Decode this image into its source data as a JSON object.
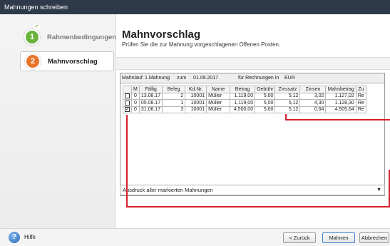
{
  "window": {
    "title": "Mahnungen schreiben"
  },
  "sidebar": {
    "steps": [
      {
        "number": "1",
        "label": "Rahmenbedingungen",
        "state": "done"
      },
      {
        "number": "2",
        "label": "Mahnvorschlag",
        "state": "active"
      }
    ]
  },
  "main": {
    "title": "Mahnvorschlag",
    "subtitle": "Prüfen Sie die zur Mahnung vorgeschlagenen Offenen Posten."
  },
  "infobar": {
    "mahnlauf_label": "Mahnlauf",
    "mahnung": "1.Mahnung",
    "zum_label": "zum",
    "date": "01.09.2017",
    "fuer_label": "für Rechnungen in",
    "currency": "EUR"
  },
  "table": {
    "headers": [
      "",
      "M",
      "Fällig",
      "Beleg",
      "Kd.Nr.",
      "Name",
      "Betrag",
      "Gebühr",
      "Zinssatz",
      "Zinsen",
      "Mahnbetrag",
      "Zu"
    ],
    "rows": [
      {
        "checked": false,
        "checkmark": "",
        "m": "0",
        "faellig": "13.08.17",
        "beleg": "2",
        "kdnr": "10001",
        "name": "Müller",
        "betrag": "1.119,00",
        "gebuehr": "5,00",
        "zinssatz": "5,12",
        "zinsen": "3,02",
        "mahnbetrag": "1.127,02",
        "zu": "Re"
      },
      {
        "checked": false,
        "checkmark": "",
        "m": "0",
        "faellig": "05.08.17",
        "beleg": "1",
        "kdnr": "10001",
        "name": "Müller",
        "betrag": "1.119,00",
        "gebuehr": "5,00",
        "zinssatz": "5,12",
        "zinsen": "4,30",
        "mahnbetrag": "1.128,30",
        "zu": "Re"
      },
      {
        "checked": true,
        "checkmark": "✓",
        "m": "0",
        "faellig": "31.08.17",
        "beleg": "3",
        "kdnr": "10001",
        "name": "Müller",
        "betrag": "4.500,00",
        "gebuehr": "5,00",
        "zinssatz": "5,12",
        "zinsen": "0,64",
        "mahnbetrag": "4.505,64",
        "zu": "Re"
      }
    ]
  },
  "print_select": {
    "value": "Ausdruck aller markierten Mahnungen"
  },
  "footer": {
    "help_label": "Hilfe",
    "back_label": "< Zurück",
    "next_label": "Mahnen",
    "cancel_label": "Abbrechen"
  },
  "colors": {
    "accent_red": "#d6202a",
    "step_done": "#6ab33c",
    "step_active": "#e8742a"
  }
}
